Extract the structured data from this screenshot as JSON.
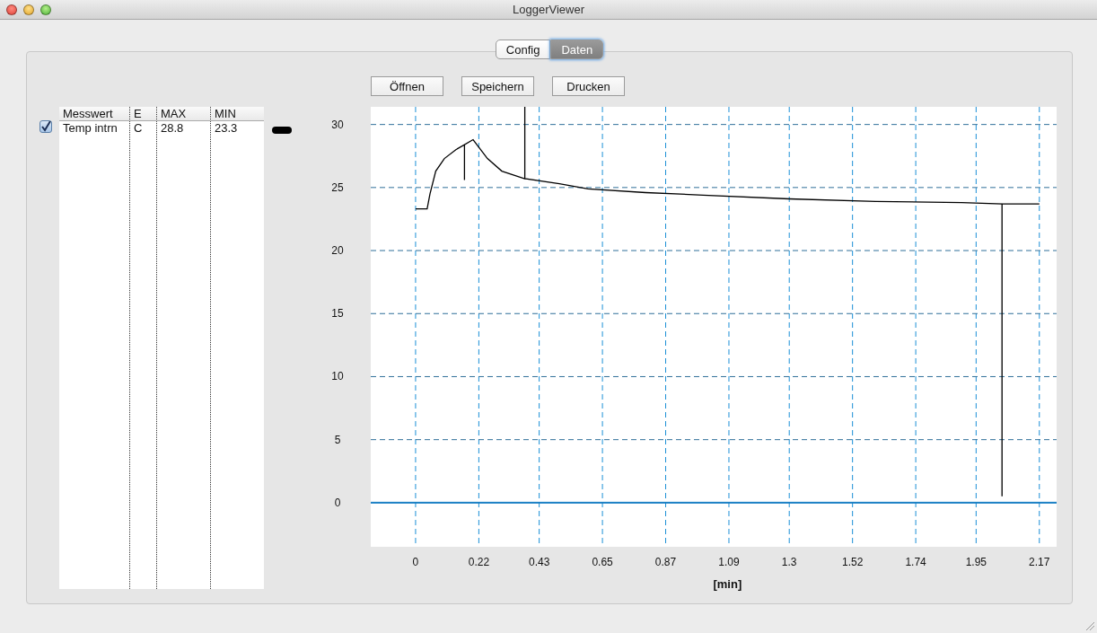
{
  "window": {
    "title": "LoggerViewer"
  },
  "tabs": [
    {
      "label": "Config",
      "selected": false
    },
    {
      "label": "Daten",
      "selected": true
    }
  ],
  "buttons": [
    "Öffnen",
    "Speichern",
    "Drucken"
  ],
  "table": {
    "columns": [
      "Messwert",
      "E",
      "MAX",
      "MIN"
    ],
    "rows": [
      {
        "checked": true,
        "cells": [
          "Temp intrn",
          "C",
          "28.8",
          "23.3"
        ],
        "color": "#000000"
      }
    ]
  },
  "chart": {
    "chart_data": {
      "type": "line",
      "xlabel": "[min]",
      "x": [
        0,
        0.04,
        0.05,
        0.07,
        0.1,
        0.14,
        0.17,
        0.17,
        0.17,
        0.2,
        0.25,
        0.3,
        0.38,
        0.38,
        0.38,
        0.5,
        0.6,
        0.8,
        1.0,
        1.3,
        1.6,
        1.9,
        2.04,
        2.04,
        2.04,
        2.17
      ],
      "series": [
        {
          "color": "#000000",
          "values": [
            23.3,
            23.3,
            24.5,
            26.3,
            27.3,
            28.0,
            28.4,
            25.6,
            28.4,
            28.8,
            27.3,
            26.3,
            25.7,
            31.4,
            25.7,
            25.3,
            24.9,
            24.6,
            24.4,
            24.1,
            23.9,
            23.8,
            23.7,
            0.5,
            23.7,
            23.7
          ]
        }
      ],
      "xlim": [
        -0.156,
        2.23
      ],
      "ylim": [
        -3.5,
        31.4
      ],
      "xticks": [
        0,
        0.22,
        0.43,
        0.65,
        0.87,
        1.09,
        1.3,
        1.52,
        1.74,
        1.95,
        2.17
      ],
      "yticks": [
        0,
        5,
        10,
        15,
        20,
        25,
        30
      ],
      "grid": true,
      "ref_lines": [
        {
          "axis": "y",
          "value": 0,
          "color": "#1a7fc4"
        }
      ]
    }
  }
}
